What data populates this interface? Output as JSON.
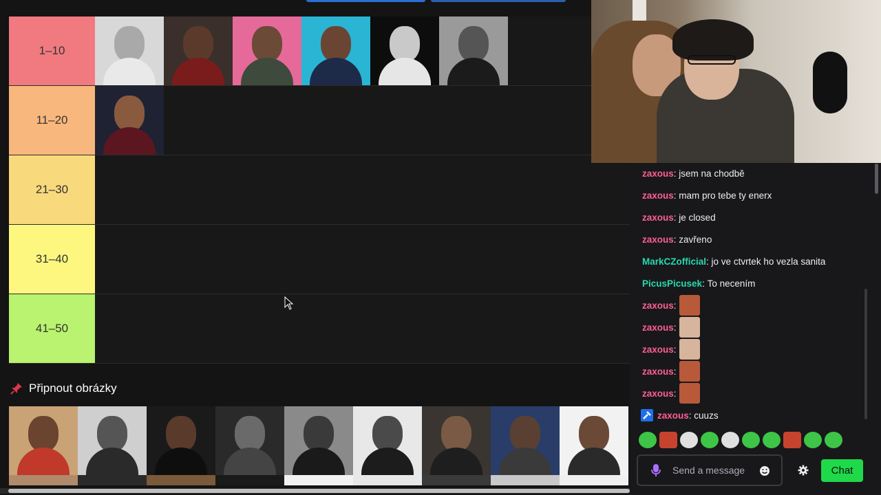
{
  "tier_list": {
    "tiers": [
      {
        "label": "1–10",
        "color": "#f07a80"
      },
      {
        "label": "11–20",
        "color": "#f8b77c"
      },
      {
        "label": "21–30",
        "color": "#f8d97c"
      },
      {
        "label": "31–40",
        "color": "#fdf77f"
      },
      {
        "label": "41–50",
        "color": "#b9f36f"
      }
    ]
  },
  "pin_section": {
    "title": "Připnout obrázky",
    "icon": "pushpin-icon"
  },
  "chat": {
    "messages": [
      {
        "user": "zaxous",
        "text": "jsem na chodbě"
      },
      {
        "user": "zaxous",
        "text": "mam pro tebe ty enerx"
      },
      {
        "user": "zaxous",
        "text": "je closed"
      },
      {
        "user": "zaxous",
        "text": "zavřeno"
      },
      {
        "user": "MarkCZofficial",
        "text": "jo ve ctvrtek ho vezla sanita"
      },
      {
        "user": "PicusPicusek",
        "text": "To necením"
      },
      {
        "user": "zaxous",
        "text": ""
      },
      {
        "user": "zaxous",
        "text": ""
      },
      {
        "user": "zaxous",
        "text": ""
      },
      {
        "user": "zaxous",
        "text": ""
      },
      {
        "user": "zaxous",
        "text": ""
      },
      {
        "user": "zaxous",
        "text": "cuuzs"
      }
    ],
    "input_placeholder": "Send a message",
    "chat_button": "Chat"
  },
  "colors": {
    "chat_button": "#1fd94a",
    "user_pink": "#ff5f8f",
    "user_teal": "#26d9b0"
  }
}
